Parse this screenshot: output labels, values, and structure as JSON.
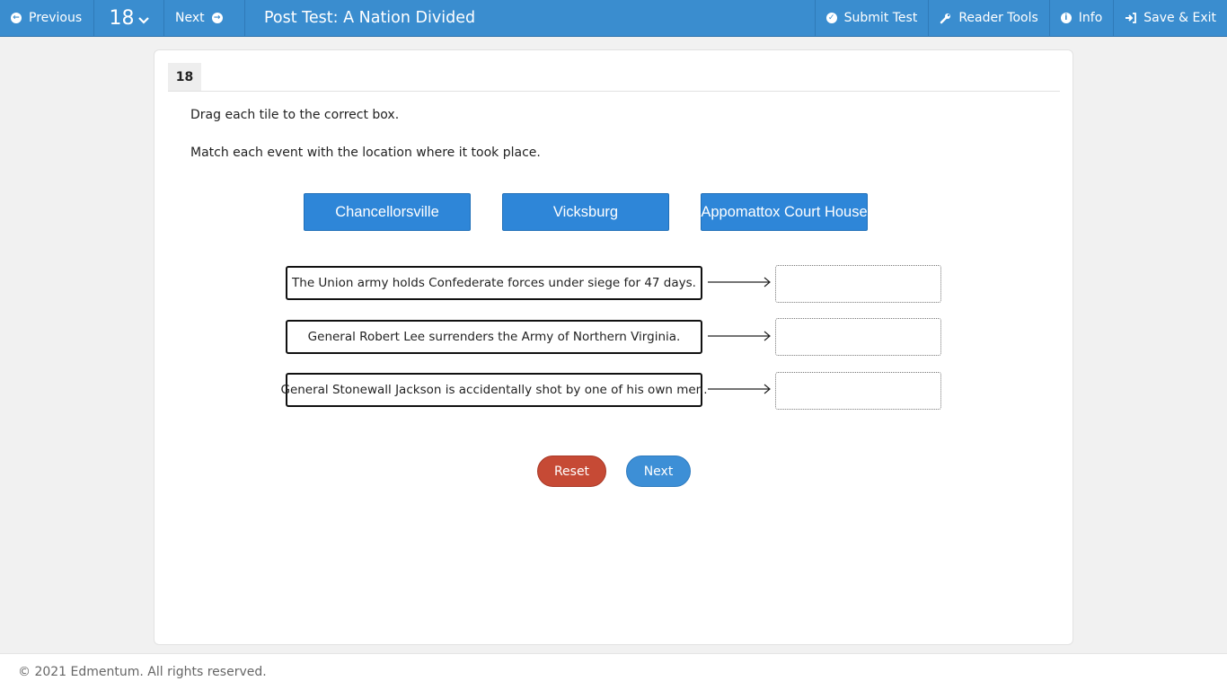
{
  "header": {
    "previous_label": "Previous",
    "question_number": "18",
    "next_label": "Next",
    "title": "Post Test: A Nation Divided",
    "submit_label": "Submit Test",
    "reader_tools_label": "Reader Tools",
    "info_label": "Info",
    "save_exit_label": "Save & Exit"
  },
  "question": {
    "number": "18",
    "instruction_1": "Drag each tile to the correct box.",
    "instruction_2": "Match each event with the location where it took place.",
    "tiles": [
      "Chancellorsville",
      "Vicksburg",
      "Appomattox Court House"
    ],
    "events": [
      "The Union army holds Confederate forces under siege for 47 days.",
      "General Robert Lee surrenders the Army of Northern Virginia.",
      "General Stonewall Jackson is accidentally shot by one of his own men."
    ],
    "reset_label": "Reset",
    "next_label": "Next"
  },
  "footer": {
    "copyright": "© 2021 Edmentum. All rights reserved."
  },
  "colors": {
    "topbar": "#3a8dcf",
    "tile": "#2e86d8",
    "reset": "#c64a35",
    "next": "#3d8fd6"
  },
  "icons": {
    "previous": "arrow-left-circle-icon",
    "number": "chevron-down-icon",
    "next": "arrow-right-circle-icon",
    "submit": "check-circle-icon",
    "reader_tools": "wrench-icon",
    "info": "info-circle-icon",
    "save_exit": "sign-out-icon"
  }
}
